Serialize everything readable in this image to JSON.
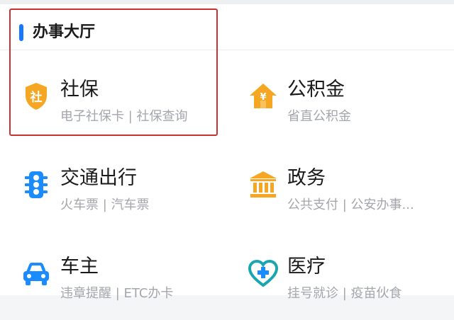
{
  "section": {
    "title": "办事大厅"
  },
  "tiles": [
    {
      "name": "社保",
      "sub": "电子社保卡 | 社保查询",
      "icon": "shield-badge-icon",
      "icon_text": "社",
      "color": "#f5a623"
    },
    {
      "name": "公积金",
      "sub": "省直公积金",
      "icon": "house-yen-icon",
      "icon_text": "¥",
      "color": "#f5a623"
    },
    {
      "name": "交通出行",
      "sub": "火车票 | 汽车票",
      "icon": "traffic-light-icon",
      "color": "#1a8cff"
    },
    {
      "name": "政务",
      "sub": "公共支付 | 公安办事...",
      "icon": "government-building-icon",
      "color": "#f5a623"
    },
    {
      "name": "车主",
      "sub": "违章提醒 | ETC办卡",
      "icon": "car-icon",
      "color": "#1a8cff"
    },
    {
      "name": "医疗",
      "sub": "挂号就诊 | 疫苗伙食",
      "icon": "medical-heart-icon",
      "color": "#1aa6b0"
    }
  ],
  "colors": {
    "accent": "#1677ff",
    "highlight_border": "#c73333",
    "title_text": "#1a1a1a",
    "sub_text": "#a3a6ab"
  }
}
